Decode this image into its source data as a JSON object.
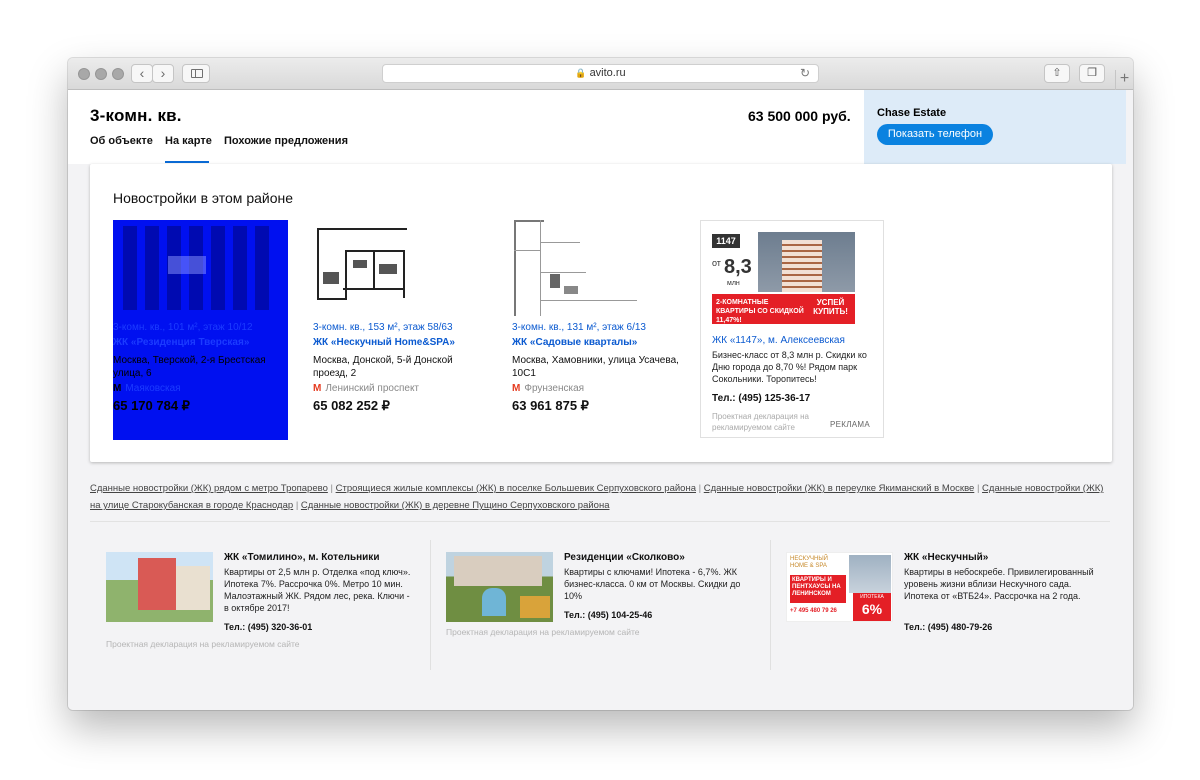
{
  "browser": {
    "url": "avito.ru"
  },
  "listing": {
    "title": "3-комн. кв.",
    "price": "63 500 000 руб.",
    "tabs": [
      "Об объекте",
      "На карте",
      "Похожие предложения"
    ],
    "active_tab": "На карте"
  },
  "seller": {
    "name": "Chase Estate",
    "phone_button": "Показать телефон"
  },
  "newbuilds": {
    "title": "Новостройки в этом районе",
    "items": [
      {
        "spec": "3-комн. кв., 101 м², этаж 10/12",
        "name": "ЖК «Резиденция Тверская»",
        "address": "Москва, Тверской, 2-я Брестская улица, 6",
        "metro": "Маяковская",
        "price": "65 170 784 ₽"
      },
      {
        "spec": "3-комн. кв., 153 м², этаж 58/63",
        "name": "ЖК «Нескучный Home&SPA»",
        "address": "Москва, Донской, 5-й Донской проезд, 2",
        "metro": "Ленинский проспект",
        "price": "65 082 252 ₽"
      },
      {
        "spec": "3-комн. кв., 131 м², этаж 6/13",
        "name": "ЖК «Садовые кварталы»",
        "address": "Москва, Хамовники, улица Усачева, 10С1",
        "metro": "Фрунзенская",
        "price": "63 961 875 ₽"
      }
    ],
    "ad": {
      "banner_logo": "1147",
      "banner_from": "от",
      "banner_price": "8,3",
      "banner_unit": "млн",
      "banner_text": "2-КОМНАТНЫЕ КВАРТИРЫ СО СКИДКОЙ 11,47%!",
      "banner_cta": "УСПЕЙ КУПИТЬ!",
      "link": "ЖК «1147», м. Алексеевская",
      "description": "Бизнес-класс от 8,3 млн р. Скидки ко Дню города до 8,70 %! Рядом парк Сокольники. Торопитесь!",
      "phone": "Тел.: (495) 125-36-17",
      "declaration": "Проектная декларация на рекламируемом сайте",
      "tag": "РЕКЛАМА"
    }
  },
  "seo_links": [
    "Сданные новостройки (ЖК) рядом с метро Тропарево",
    "Строящиеся жилые комплексы (ЖК) в поселке Большевик Серпуховского района",
    "Сданные новостройки (ЖК) в переулке Якиманский в Москве",
    "Сданные новостройки (ЖК) на улице Старокубанская в городе Краснодар",
    "Сданные новостройки (ЖК) в деревне Пущино Серпуховского района"
  ],
  "promos": [
    {
      "title": "ЖК «Томилино», м. Котельники",
      "description": "Квартиры от 2,5 млн р. Отделка «под ключ». Ипотека 7%. Рассрочка 0%. Метро 10 мин. Малоэтажный ЖК. Рядом лес, река. Ключи - в октябре 2017!",
      "phone": "Тел.: (495) 320-36-01",
      "declaration": "Проектная декларация на рекламируемом сайте"
    },
    {
      "title": "Резиденции «Сколково»",
      "description": "Квартиры с ключами! Ипотека - 6,7%. ЖК бизнес-класса. 0 км от Москвы. Скидки до 10%",
      "phone": "Тел.: (495) 104-25-46",
      "declaration": "Проектная декларация на рекламируемом сайте"
    },
    {
      "title": "ЖК «Нескучный»",
      "description": "Квартиры в небоскребе. Привилегированный уровень жизни вблизи Нескучного сада. Ипотека от «ВТБ24». Рассрочка на 2 года.",
      "phone": "Тел.: (495) 480-79-26",
      "banner_brand": "НЕСКУЧНЫЙ HOME & SPA",
      "banner_text": "КВАРТИРЫ И ПЕНТХАУСЫ НА ЛЕНИНСКОМ",
      "banner_phone": "+7 495 480 79 26",
      "banner_label": "ИПОТЕКА",
      "banner_rate": "6%"
    }
  ],
  "colors": {
    "accent": "#0a82e0",
    "link": "#0b5ad0",
    "metro": "#e53a1e",
    "seller_bg": "#ddebf8",
    "ad_red": "#e41f26",
    "highlight": "#0010f0"
  }
}
